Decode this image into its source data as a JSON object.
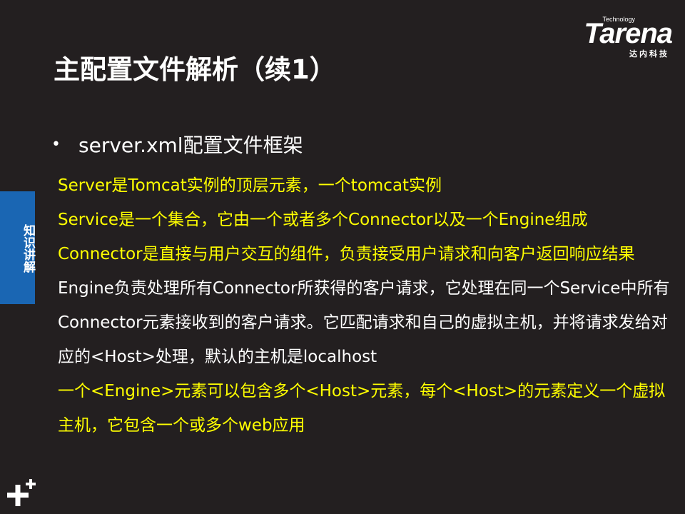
{
  "logo": {
    "tagline": "Technology",
    "wordmark": "Tarena",
    "chinese": "达内科技"
  },
  "title": "主配置文件解析（续1）",
  "side_tab": {
    "label": "知识讲解"
  },
  "bullet": {
    "symbol": "•",
    "text": "server.xml配置文件框架"
  },
  "colors": {
    "background": "#231f20",
    "highlight": "#ffff00",
    "normal": "#ffffff",
    "tab": "#1a66b3"
  },
  "paragraphs": [
    {
      "text": "Server是Tomcat实例的顶层元素，一个tomcat实例",
      "color": "#ffff00"
    },
    {
      "text": "Service是一个集合，它由一个或者多个Connector以及一个Engine组成",
      "color": "#ffff00"
    },
    {
      "text": "Connector是直接与用户交互的组件，负责接受用户请求和向客户返回响应结果",
      "color": "#ffff00"
    },
    {
      "text": "Engine负责处理所有Connector所获得的客户请求，它处理在同一个Service中所有Connector元素接收到的客户请求。它匹配请求和自己的虚拟主机，并将请求发给对应的<Host>处理，默认的主机是localhost",
      "color": "#ffffff"
    },
    {
      "text": "一个<Engine>元素可以包含多个<Host>元素，每个<Host>的元素定义一个虚拟主机，它包含一个或多个web应用",
      "color": "#ffff00"
    }
  ],
  "corner_icon": "plus-plus-icon"
}
